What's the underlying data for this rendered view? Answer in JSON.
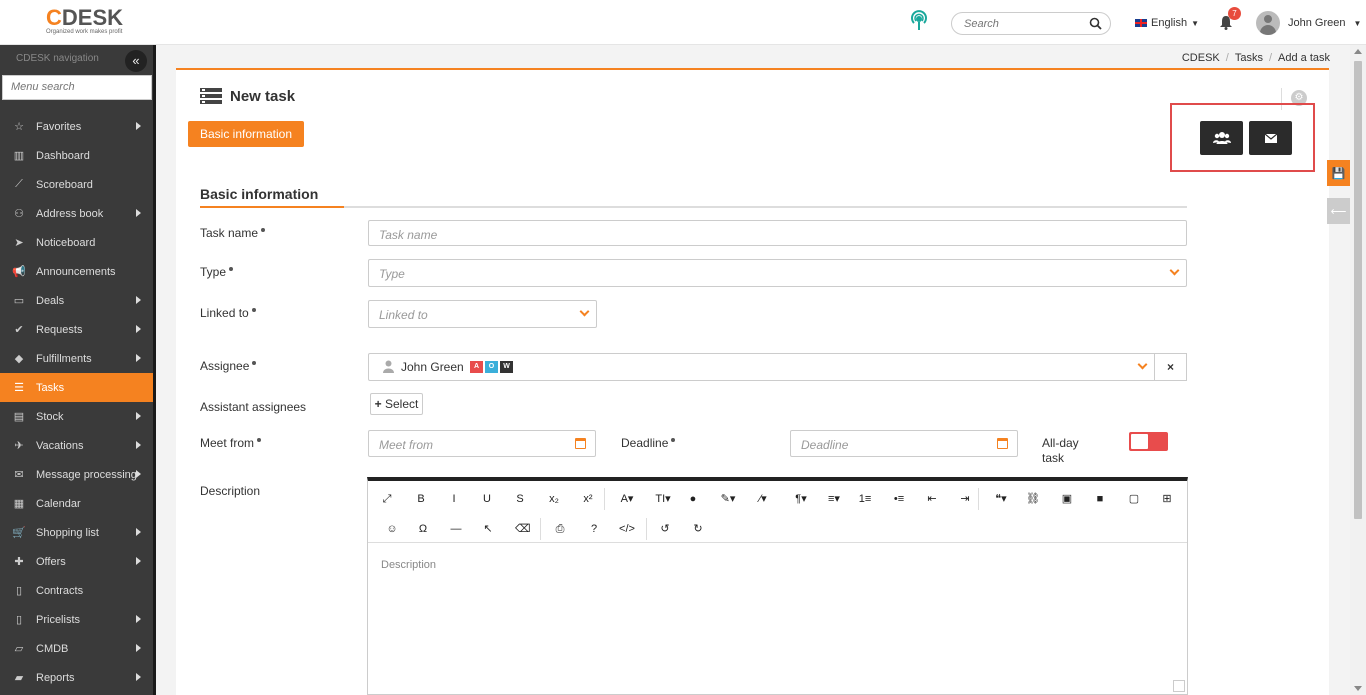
{
  "topbar": {
    "logo_text": "CDESK",
    "logo_tagline": "Organized work makes profit",
    "search_placeholder": "Search",
    "language": "English",
    "notification_count": "7",
    "user_name": "John Green"
  },
  "sidebar": {
    "title": "CDESK navigation",
    "menu_search_placeholder": "Menu search",
    "items": [
      {
        "label": "Favorites",
        "icon": "star-icon",
        "submenu": true
      },
      {
        "label": "Dashboard",
        "icon": "bar-chart-icon",
        "submenu": false
      },
      {
        "label": "Scoreboard",
        "icon": "line-chart-icon",
        "submenu": false
      },
      {
        "label": "Address book",
        "icon": "user-icon",
        "submenu": true
      },
      {
        "label": "Noticeboard",
        "icon": "send-icon",
        "submenu": false
      },
      {
        "label": "Announcements",
        "icon": "bullhorn-icon",
        "submenu": false
      },
      {
        "label": "Deals",
        "icon": "money-icon",
        "submenu": true
      },
      {
        "label": "Requests",
        "icon": "check-circle-icon",
        "submenu": true
      },
      {
        "label": "Fulfillments",
        "icon": "cube-icon",
        "submenu": true
      },
      {
        "label": "Tasks",
        "icon": "tasks-icon",
        "submenu": false,
        "active": true
      },
      {
        "label": "Stock",
        "icon": "archive-icon",
        "submenu": true
      },
      {
        "label": "Vacations",
        "icon": "plane-icon",
        "submenu": true
      },
      {
        "label": "Message processing",
        "icon": "envelope-icon",
        "submenu": true
      },
      {
        "label": "Calendar",
        "icon": "calendar-icon",
        "submenu": false
      },
      {
        "label": "Shopping list",
        "icon": "cart-icon",
        "submenu": true
      },
      {
        "label": "Offers",
        "icon": "gift-icon",
        "submenu": true
      },
      {
        "label": "Contracts",
        "icon": "file-icon",
        "submenu": false
      },
      {
        "label": "Pricelists",
        "icon": "file-text-icon",
        "submenu": true
      },
      {
        "label": "CMDB",
        "icon": "folder-open-icon",
        "submenu": true
      },
      {
        "label": "Reports",
        "icon": "folder-icon",
        "submenu": true
      }
    ]
  },
  "breadcrumb": [
    "CDESK",
    "Tasks",
    "Add a task"
  ],
  "page": {
    "title": "New task",
    "tab_label": "Basic information",
    "section_title": "Basic information"
  },
  "form": {
    "task_name_label": "Task name",
    "task_name_placeholder": "Task name",
    "type_label": "Type",
    "type_placeholder": "Type",
    "linked_to_label": "Linked to",
    "linked_to_placeholder": "Linked to",
    "assignee_label": "Assignee",
    "assignee_value": "John Green",
    "assignee_badges": [
      "A",
      "O",
      "W"
    ],
    "clear_symbol": "×",
    "assistant_label": "Assistant assignees",
    "select_button": "Select",
    "meet_from_label": "Meet from",
    "meet_from_placeholder": "Meet from",
    "deadline_label": "Deadline",
    "deadline_placeholder": "Deadline",
    "allday_label_line1": "All-day",
    "allday_label_line2": "task",
    "allday_checked": false,
    "description_label": "Description",
    "description_placeholder": "Description"
  },
  "editor_toolbar": {
    "row1": [
      "⤢",
      "B",
      "I",
      "U",
      "S",
      "x₂",
      "x²",
      "A▾",
      "TI▾",
      "●",
      "✎▾",
      "⁄▾",
      "¶▾",
      "≡▾",
      "1≡",
      "•≡",
      "⇤",
      "⇥",
      "❝▾",
      "⛓",
      "▣",
      "■",
      "▢",
      "⊞"
    ],
    "row2": [
      "☺",
      "Ω",
      "—",
      "↖",
      "⌫",
      "⎙",
      "?",
      "</>",
      "↺",
      "↻"
    ]
  },
  "colors": {
    "accent": "#f58220",
    "sidebar_bg": "#3a3a3a",
    "highlight_box": "#e04b4b",
    "toggle_off": "#e84c4c"
  }
}
